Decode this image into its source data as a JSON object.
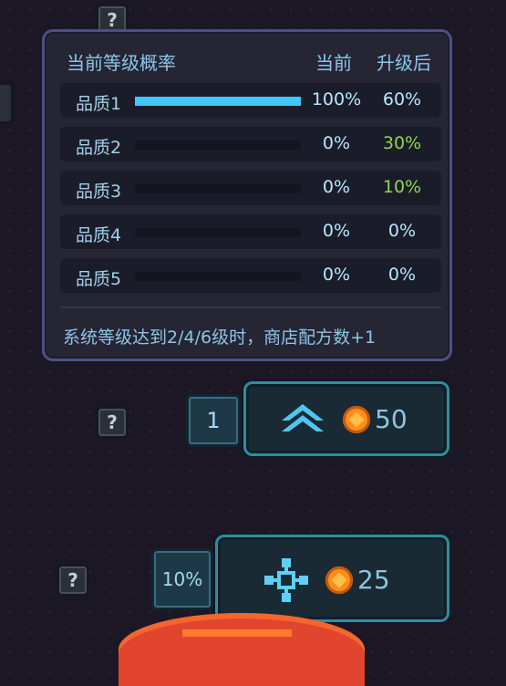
{
  "help_icon": "?",
  "probability_panel": {
    "header": {
      "title": "当前等级概率",
      "current": "当前",
      "upgraded": "升级后"
    },
    "rows": [
      {
        "label": "品质1",
        "fill": 1.0,
        "current": "100%",
        "upgraded": "60%",
        "upgraded_color": "#b7e8ff"
      },
      {
        "label": "品质2",
        "fill": 0.0,
        "current": "0%",
        "upgraded": "30%",
        "upgraded_color": "#8ed84e"
      },
      {
        "label": "品质3",
        "fill": 0.0,
        "current": "0%",
        "upgraded": "10%",
        "upgraded_color": "#8ed84e"
      },
      {
        "label": "品质4",
        "fill": 0.0,
        "current": "0%",
        "upgraded": "0%",
        "upgraded_color": "#b7e8ff"
      },
      {
        "label": "品质5",
        "fill": 0.0,
        "current": "0%",
        "upgraded": "0%",
        "upgraded_color": "#b7e8ff"
      }
    ],
    "note": "系统等级达到2/4/6级时，商店配方数+1"
  },
  "upgrade": {
    "level": "1",
    "icon": "chevron-up-icon",
    "cost": "50"
  },
  "recipe": {
    "chance": "10%",
    "icon": "crosshair-icon",
    "cost": "25"
  },
  "colors": {
    "bar_fill": "#3ec8ff",
    "coin": "#ff8d1e",
    "panel_border": "#4d4f86",
    "button_border": "#2f8da0"
  }
}
